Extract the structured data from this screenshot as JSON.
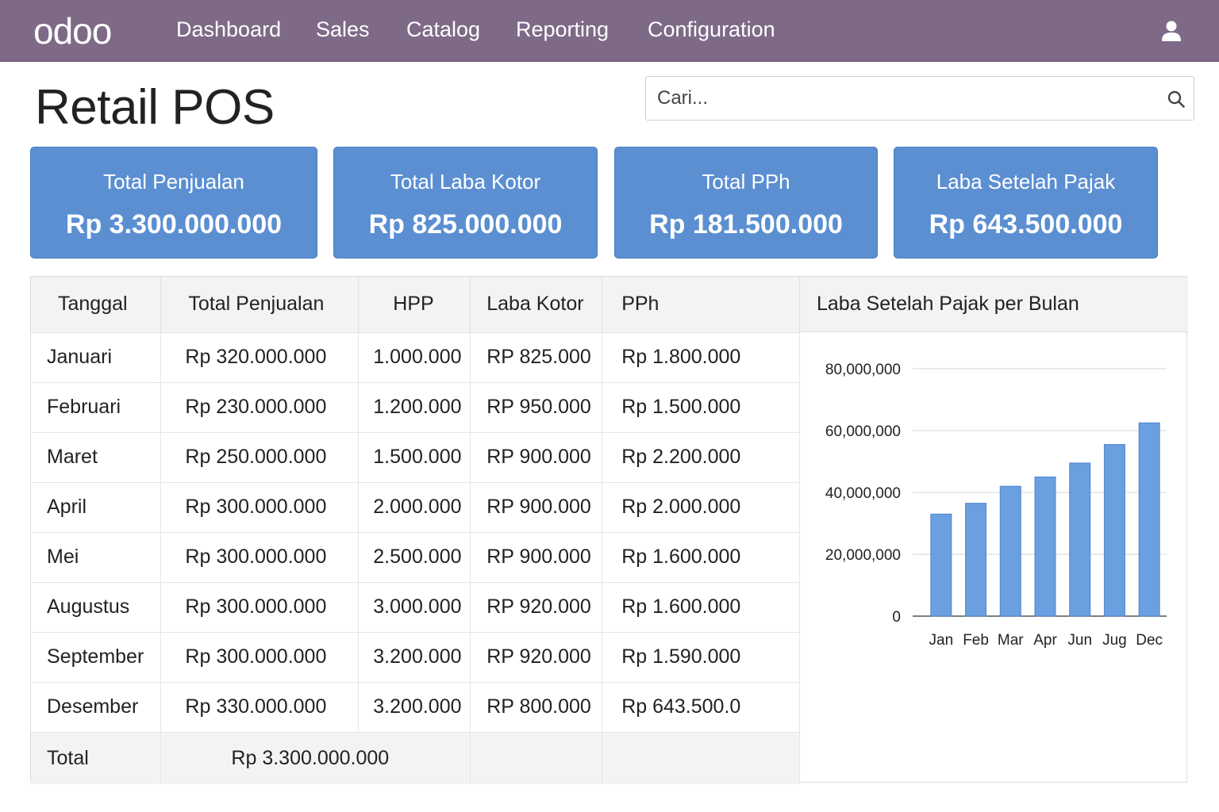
{
  "nav": {
    "logo": "odoo",
    "items": [
      "Dashboard",
      "Sales",
      "Catalog",
      "Reporting",
      "Configuration"
    ]
  },
  "page": {
    "title": "Retail POS"
  },
  "search": {
    "placeholder": "Cari..."
  },
  "kpis": [
    {
      "label": "Total Penjualan",
      "value": "Rp 3.300.000.000"
    },
    {
      "label": "Total Laba Kotor",
      "value": "Rp 825.000.000"
    },
    {
      "label": "Total PPh",
      "value": "Rp 181.500.000"
    },
    {
      "label": "Laba Setelah Pajak",
      "value": "Rp 643.500.000"
    }
  ],
  "table": {
    "headers": [
      "Tanggal",
      "Total Penjualan",
      "HPP",
      "Laba Kotor",
      "PPh"
    ],
    "rows": [
      [
        "Januari",
        "Rp 320.000.000",
        "1.000.000",
        "RP 825.000",
        "Rp 1.800.000"
      ],
      [
        "Februari",
        "Rp 230.000.000",
        "1.200.000",
        "RP 950.000",
        "Rp 1.500.000"
      ],
      [
        "Maret",
        "Rp 250.000.000",
        "1.500.000",
        "RP 900.000",
        "Rp 2.200.000"
      ],
      [
        "April",
        "Rp 300.000.000",
        "2.000.000",
        "RP 900.000",
        "Rp 2.000.000"
      ],
      [
        "Mei",
        "Rp 300.000.000",
        "2.500.000",
        "RP 900.000",
        "Rp 1.600.000"
      ],
      [
        "Augustus",
        "Rp 300.000.000",
        "3.000.000",
        "RP 920.000",
        "Rp 1.600.000"
      ],
      [
        "September",
        "Rp 300.000.000",
        "3.200.000",
        "RP 920.000",
        "Rp 1.590.000"
      ],
      [
        "Desember",
        "Rp 330.000.000",
        "3.200.000",
        "RP 800.000",
        "Rp 643.500.0"
      ]
    ],
    "total_label": "Total",
    "total_value": "Rp 3.300.000.000"
  },
  "chart_data": {
    "type": "bar",
    "title": "Laba Setelah Pajak per Bulan",
    "categories": [
      "Jan",
      "Feb",
      "Mar",
      "Apr",
      "Jun",
      "Jug",
      "Dec"
    ],
    "values": [
      33000000,
      36500000,
      42000000,
      45000000,
      49500000,
      55500000,
      62500000
    ],
    "yticks": [
      "0",
      "20,000,000",
      "40,000,000",
      "60,000,000",
      "80,000,000"
    ],
    "ylim": [
      0,
      80000000
    ],
    "grid": true,
    "bar_color": "#6a9fe0"
  },
  "colors": {
    "navbar": "#7e6a87",
    "kpi_card": "#5b8fd2",
    "header_bg": "#f3f3f3"
  },
  "icons": {
    "user": "user-icon",
    "search": "search-icon"
  }
}
